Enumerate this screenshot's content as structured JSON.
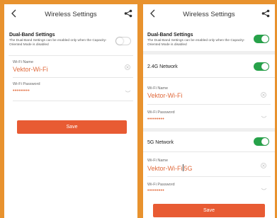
{
  "left": {
    "title": "Wireless Settings",
    "dual_band": {
      "label": "Dual-Band Settings",
      "hint": "The Dual-Band Settings can be enabled only when the Capacity-Oriented Mode is disabled",
      "enabled": false
    },
    "wifi_name": {
      "label": "Wi-Fi Name",
      "value": "Vektor-Wi-Fi"
    },
    "wifi_password": {
      "label": "Wi-Fi Password",
      "value": "•••••••••"
    },
    "save_label": "Save"
  },
  "right": {
    "title": "Wireless Settings",
    "dual_band": {
      "label": "Dual-Band Settings",
      "hint": "The Dual-Band Settings can be enabled only when the Capacity-Oriented Mode is disabled",
      "enabled": true
    },
    "network_24": {
      "title": "2.4G Network",
      "enabled": true,
      "wifi_name": {
        "label": "Wi-Fi Name",
        "value": "Vektor-Wi-Fi"
      },
      "wifi_password": {
        "label": "Wi-Fi Password",
        "value": "•••••••••"
      }
    },
    "network_5": {
      "title": "5G Network",
      "enabled": true,
      "wifi_name": {
        "label": "Wi-Fi Name",
        "value_before_cursor": "Vektor-Wi-Fi",
        "value_after_cursor": "5G"
      },
      "wifi_password": {
        "label": "Wi-Fi Password",
        "value": "•••••••••"
      }
    },
    "save_label": "Save"
  },
  "colors": {
    "frame": "#e8922e",
    "accent": "#e85b33",
    "value_text": "#e06a3c",
    "toggle_on": "#27a24a"
  },
  "icons": {
    "back": "chevron-left-icon",
    "share": "share-icon",
    "clear": "clear-circle-icon",
    "password_visibility": "eye-closed-icon"
  }
}
